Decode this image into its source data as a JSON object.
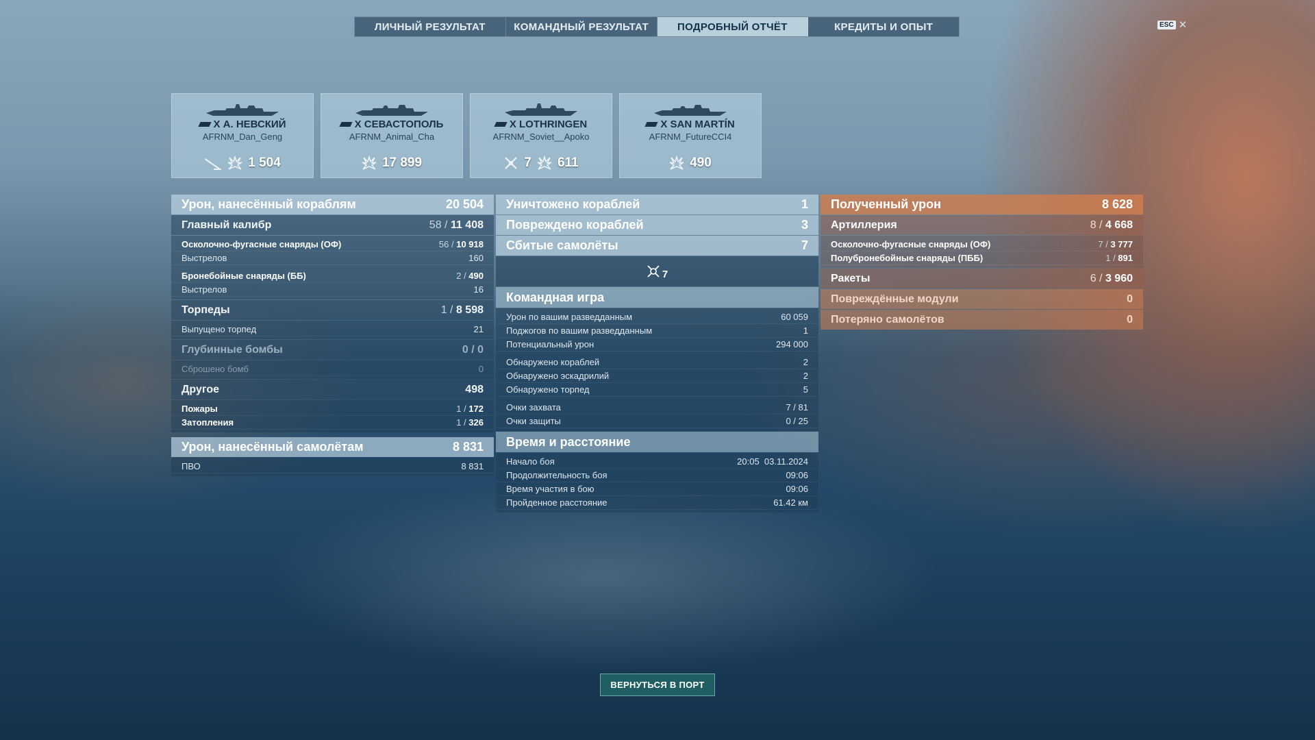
{
  "tabs": [
    "ЛИЧНЫЙ РЕЗУЛЬТАТ",
    "КОМАНДНЫЙ РЕЗУЛЬТАТ",
    "ПОДРОБНЫЙ ОТЧЁТ",
    "КРЕДИТЫ И ОПЫТ"
  ],
  "active_tab": "ПОДРОБНЫЙ ОТЧЁТ",
  "esc": {
    "key": "ESC",
    "close": "✕"
  },
  "cards": [
    {
      "ship": "X А. НЕВСКИЙ",
      "player": "AFRNM_Dan_Geng",
      "icons": [
        "torpedo-icon",
        "damage-icon"
      ],
      "value": "1 504"
    },
    {
      "ship": "X СЕВАСТОПОЛЬ",
      "player": "AFRNM_Animal_Cha",
      "icons": [
        "damage-icon"
      ],
      "value": "17 899"
    },
    {
      "ship": "X LOTHRINGEN",
      "player": "AFRNM_Soviet__Apoko",
      "icons": [
        "plane-icon",
        "damage-icon"
      ],
      "plane_count": "7",
      "value": "611"
    },
    {
      "ship": "X SAN MARTÍN",
      "player": "AFRNM_FutureCCI4",
      "icons": [
        "damage-icon"
      ],
      "value": "490"
    }
  ],
  "left": {
    "ship_damage": {
      "label": "Урон, нанесённый кораблям",
      "value": "20 504"
    },
    "main_battery": {
      "label": "Главный калибр",
      "hits": "58",
      "total": "11 408"
    },
    "he": {
      "label": "Осколочно-фугасные снаряды (ОФ)",
      "hits": "56",
      "total": "10 918"
    },
    "he_shots": {
      "label": "Выстрелов",
      "value": "160"
    },
    "ap": {
      "label": "Бронебойные снаряды (ББ)",
      "hits": "2",
      "total": "490"
    },
    "ap_shots": {
      "label": "Выстрелов",
      "value": "16"
    },
    "torpedoes": {
      "label": "Торпеды",
      "hits": "1",
      "total": "8 598"
    },
    "torpedoes_fired": {
      "label": "Выпущено торпед",
      "value": "21"
    },
    "depth": {
      "label": "Глубинные бомбы",
      "hits": "0",
      "total": "0"
    },
    "bombs_dropped": {
      "label": "Сброшено бомб",
      "value": "0"
    },
    "other": {
      "label": "Другое",
      "value": "498"
    },
    "fires": {
      "label": "Пожары",
      "hits": "1",
      "total": "172"
    },
    "floods": {
      "label": "Затопления",
      "hits": "1",
      "total": "326"
    },
    "plane_damage": {
      "label": "Урон, нанесённый самолётам",
      "value": "8 831"
    },
    "aa": {
      "label": "ПВО",
      "value": "8 831"
    }
  },
  "middle": {
    "destroyed": {
      "label": "Уничтожено кораблей",
      "value": "1"
    },
    "damaged": {
      "label": "Повреждено кораблей",
      "value": "3"
    },
    "planes": {
      "label": "Сбитые самолёты",
      "value": "7"
    },
    "planes_icon_count": "7",
    "team_title": "Командная игра",
    "team": [
      {
        "label": "Урон по вашим разведданным",
        "value": "60 059"
      },
      {
        "label": "Поджогов по вашим разведданным",
        "value": "1"
      },
      {
        "label": "Потенциальный урон",
        "value": "294 000"
      }
    ],
    "spot": [
      {
        "label": "Обнаружено кораблей",
        "value": "2"
      },
      {
        "label": "Обнаружено эскадрилий",
        "value": "2"
      },
      {
        "label": "Обнаружено торпед",
        "value": "5"
      }
    ],
    "caps": [
      {
        "label": "Очки захвата",
        "value": "7 / 81"
      },
      {
        "label": "Очки защиты",
        "value": "0 / 25"
      }
    ],
    "time_title": "Время и расстояние",
    "time": [
      {
        "label": "Начало боя",
        "value": "20:05  03.11.2024"
      },
      {
        "label": "Продолжительность боя",
        "value": "09:06"
      },
      {
        "label": "Время участия в бою",
        "value": "09:06"
      },
      {
        "label": "Пройденное расстояние",
        "value": "61.42 км"
      }
    ]
  },
  "right": {
    "received": {
      "label": "Полученный урон",
      "value": "8 628"
    },
    "artillery": {
      "label": "Артиллерия",
      "hits": "8",
      "total": "4 668"
    },
    "he": {
      "label": "Осколочно-фугасные снаряды (ОФ)",
      "hits": "7",
      "total": "3 777"
    },
    "sap": {
      "label": "Полубронебойные снаряды (ПББ)",
      "hits": "1",
      "total": "891"
    },
    "rockets": {
      "label": "Ракеты",
      "hits": "6",
      "total": "3 960"
    },
    "modules": {
      "label": "Повреждённые модули",
      "value": "0"
    },
    "planes_lost": {
      "label": "Потеряно самолётов",
      "value": "0"
    }
  },
  "port_button": "ВЕРНУТЬСЯ В ПОРТ",
  "colors": {
    "active_tab": "#b9cfdc",
    "received_header": "#cd7d50",
    "port_button": "#1f5f63"
  }
}
